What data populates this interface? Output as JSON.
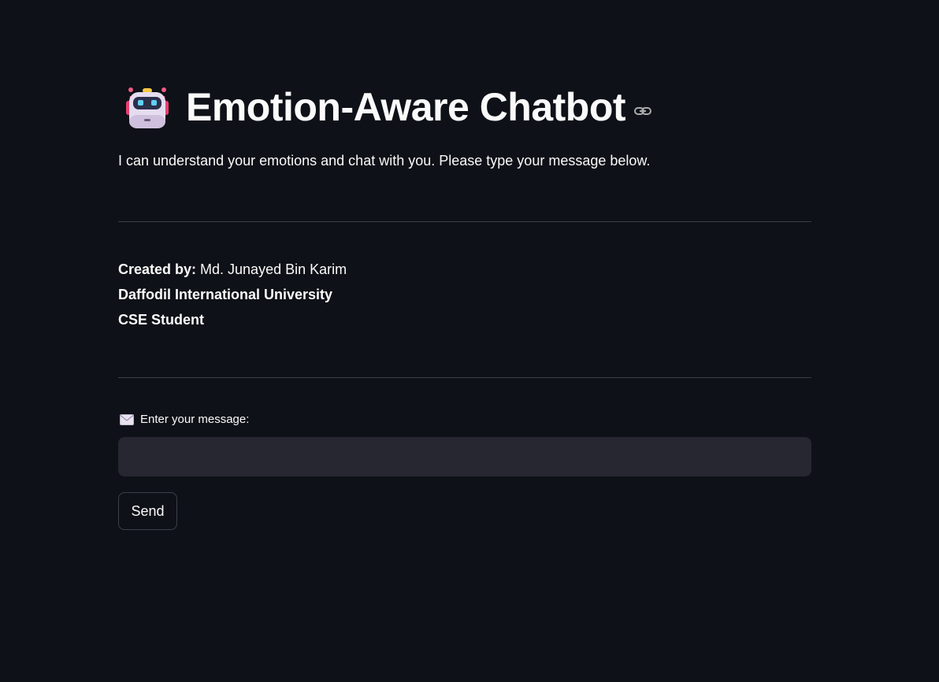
{
  "header": {
    "title": "Emotion-Aware Chatbot",
    "title_icon": "robot-icon",
    "anchor_icon": "link-icon",
    "subtitle": "I can understand your emotions and chat with you. Please type your message below."
  },
  "credits": {
    "created_by_label": "Created by:",
    "author": " Md. Junayed Bin Karim",
    "university": "Daffodil International University",
    "role": "CSE Student"
  },
  "form": {
    "label_icon": "envelope-icon",
    "label": "Enter your message:",
    "input_value": "",
    "input_placeholder": "",
    "send_label": "Send"
  },
  "colors": {
    "background": "#0e1117",
    "input_background": "#262730",
    "text": "#fafafa",
    "divider": "#3a3d45"
  }
}
